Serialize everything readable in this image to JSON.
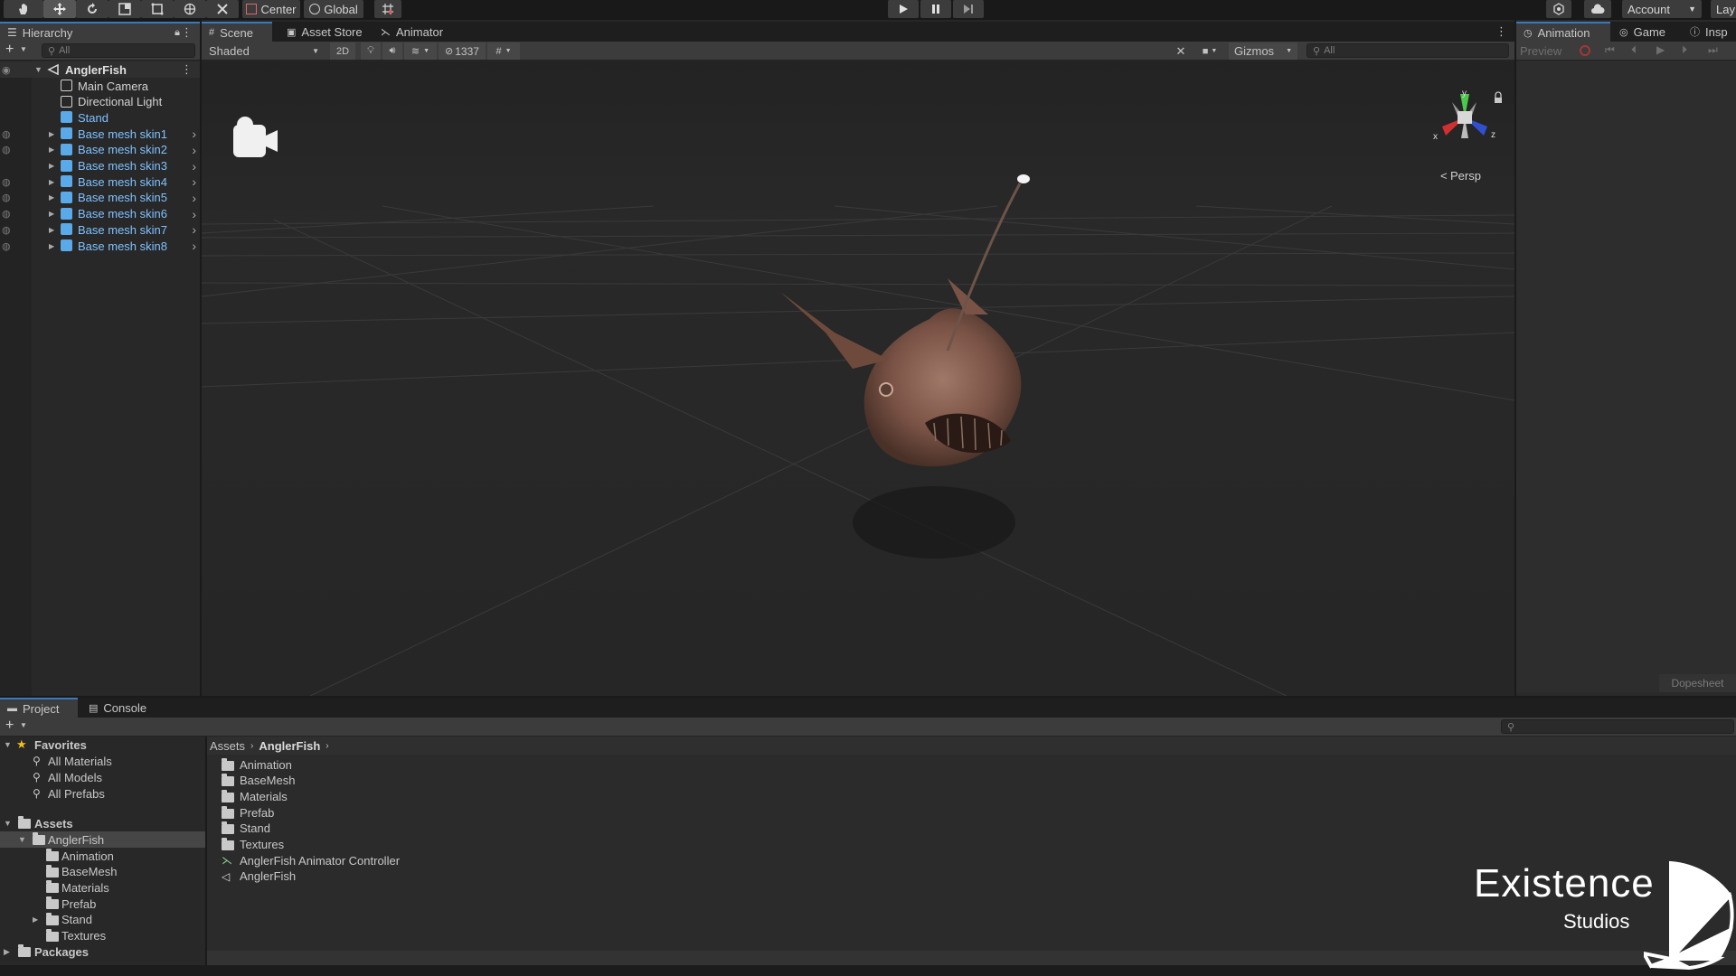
{
  "topbar": {
    "center_label": "Center",
    "global_label": "Global",
    "account_label": "Account",
    "layers_label": "Lay"
  },
  "hierarchy": {
    "tab_label": "Hierarchy",
    "search_placeholder": "All",
    "root": "AnglerFish",
    "items": [
      {
        "label": "Main Camera",
        "blue": false,
        "eye": false,
        "arrow": false,
        "icon": "gameobject-icon"
      },
      {
        "label": "Directional Light",
        "blue": false,
        "eye": false,
        "arrow": false,
        "icon": "gameobject-icon"
      },
      {
        "label": "Stand",
        "blue": true,
        "eye": false,
        "arrow": false,
        "icon": "prefab-icon"
      },
      {
        "label": "Base mesh skin1",
        "blue": true,
        "eye": true,
        "arrow": true,
        "icon": "prefab-icon"
      },
      {
        "label": "Base mesh skin2",
        "blue": true,
        "eye": true,
        "arrow": true,
        "icon": "prefab-icon"
      },
      {
        "label": "Base mesh skin3",
        "blue": true,
        "eye": false,
        "arrow": true,
        "icon": "prefab-icon"
      },
      {
        "label": "Base mesh skin4",
        "blue": true,
        "eye": true,
        "arrow": true,
        "icon": "prefab-icon"
      },
      {
        "label": "Base mesh skin5",
        "blue": true,
        "eye": true,
        "arrow": true,
        "icon": "prefab-icon"
      },
      {
        "label": "Base mesh skin6",
        "blue": true,
        "eye": true,
        "arrow": true,
        "icon": "prefab-icon"
      },
      {
        "label": "Base mesh skin7",
        "blue": true,
        "eye": true,
        "arrow": true,
        "icon": "prefab-icon"
      },
      {
        "label": "Base mesh skin8",
        "blue": true,
        "eye": true,
        "arrow": true,
        "icon": "prefab-icon"
      }
    ]
  },
  "scene": {
    "tabs": [
      {
        "label": "Scene"
      },
      {
        "label": "Asset Store"
      },
      {
        "label": "Animator"
      }
    ],
    "shading_mode": "Shaded",
    "mode_2d": "2D",
    "hidden_count": "1337",
    "gizmos_label": "Gizmos",
    "search_placeholder": "All",
    "persp_label": "Persp",
    "axis_y": "y",
    "axis_x": "x",
    "axis_z": "z"
  },
  "right_panel": {
    "tabs": [
      {
        "label": "Animation"
      },
      {
        "label": "Game"
      },
      {
        "label": "Insp"
      }
    ],
    "preview_label": "Preview",
    "dopesheet_label": "Dopesheet"
  },
  "bottom": {
    "tabs": [
      {
        "label": "Project"
      },
      {
        "label": "Console"
      }
    ],
    "tree": {
      "favorites_label": "Favorites",
      "favorites": [
        "All Materials",
        "All Models",
        "All Prefabs"
      ],
      "assets_label": "Assets",
      "anglerfish_label": "AnglerFish",
      "anglerfish_children": [
        "Animation",
        "BaseMesh",
        "Materials",
        "Prefab",
        "Stand",
        "Textures"
      ],
      "packages_label": "Packages"
    },
    "breadcrumb": [
      "Assets",
      "AnglerFish"
    ],
    "files": [
      {
        "label": "Animation",
        "type": "folder"
      },
      {
        "label": "BaseMesh",
        "type": "folder"
      },
      {
        "label": "Materials",
        "type": "folder"
      },
      {
        "label": "Prefab",
        "type": "folder"
      },
      {
        "label": "Stand",
        "type": "folder"
      },
      {
        "label": "Textures",
        "type": "folder"
      },
      {
        "label": "AnglerFish Animator Controller",
        "type": "animator"
      },
      {
        "label": "AnglerFish",
        "type": "scene"
      }
    ]
  },
  "watermark": {
    "line1": "Existence",
    "line2": "Studios"
  },
  "colors": {
    "accent": "#3a79bb",
    "prefab_blue": "#7fc1ff",
    "panel": "#282828",
    "viewport": "#262626"
  }
}
